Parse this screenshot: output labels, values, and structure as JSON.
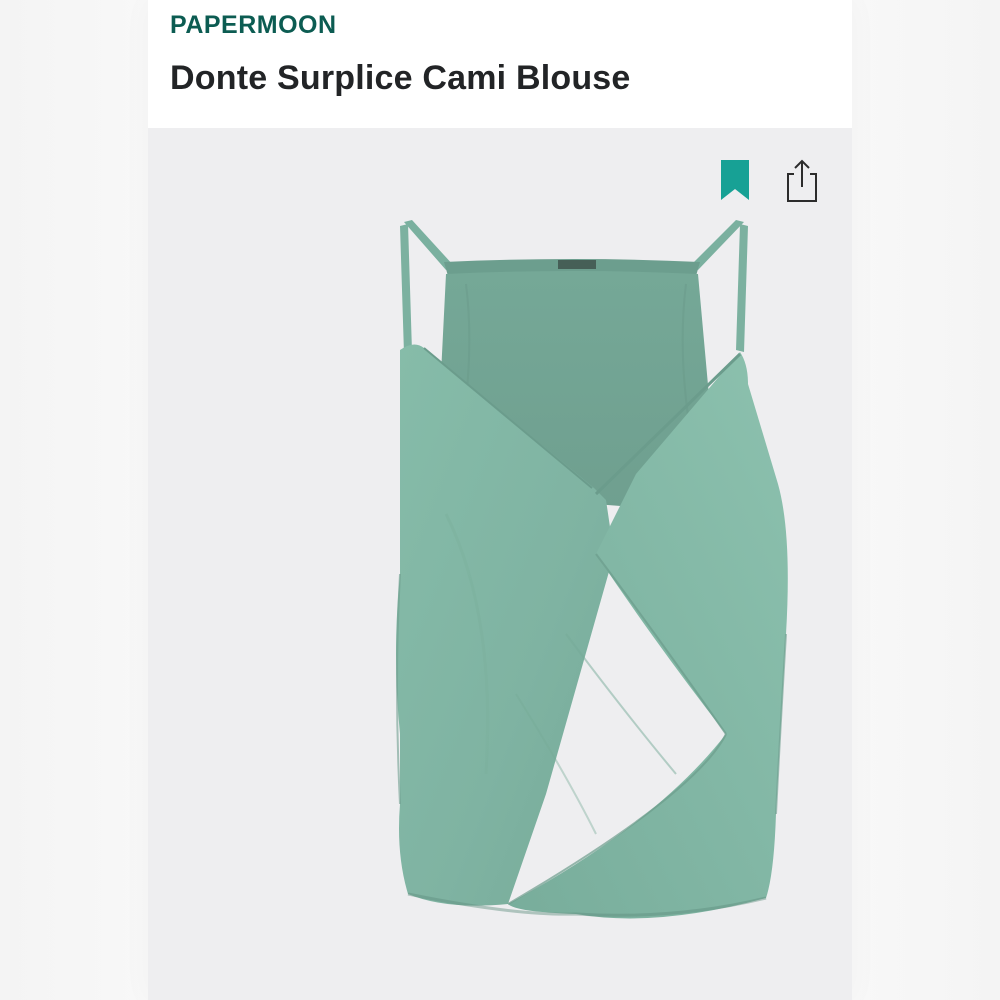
{
  "header": {
    "brand": "PAPERMOON",
    "title": "Donte Surplice Cami Blouse"
  },
  "actions": {
    "bookmark_icon": "bookmark-icon",
    "share_icon": "share-icon"
  },
  "product": {
    "garment_color": "#7fb3a2"
  },
  "colors": {
    "brand": "#0c5c52",
    "accent": "#17a195",
    "page_background": "#eeeef0"
  }
}
